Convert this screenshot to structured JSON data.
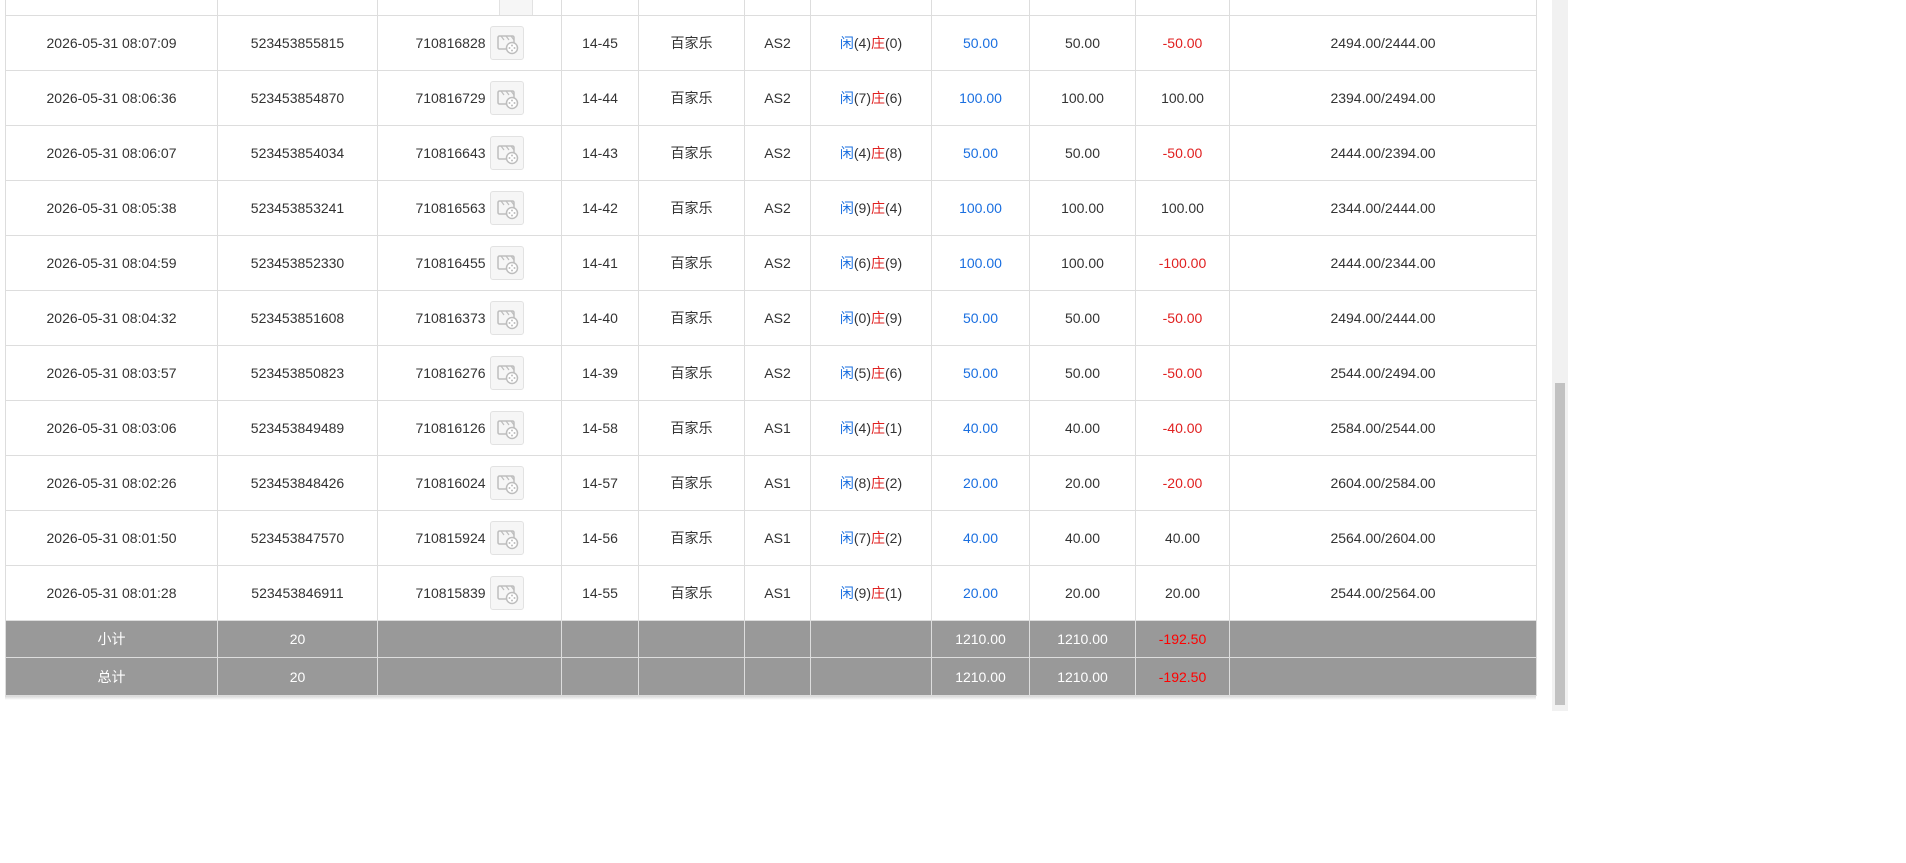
{
  "rows": [
    {
      "time": "2026-05-31 08:07:09",
      "order_id": "523453855815",
      "game_id": "710816828",
      "round": "14-45",
      "game": "百家乐",
      "table": "AS2",
      "player_label": "闲",
      "player_score": "(4)",
      "banker_label": "庄",
      "banker_score": "(0)",
      "bet": "50.00",
      "valid_bet": "50.00",
      "win_loss": "-50.00",
      "win_negative": true,
      "balance": "2494.00/2444.00"
    },
    {
      "time": "2026-05-31 08:06:36",
      "order_id": "523453854870",
      "game_id": "710816729",
      "round": "14-44",
      "game": "百家乐",
      "table": "AS2",
      "player_label": "闲",
      "player_score": "(7)",
      "banker_label": "庄",
      "banker_score": "(6)",
      "bet": "100.00",
      "valid_bet": "100.00",
      "win_loss": "100.00",
      "win_negative": false,
      "balance": "2394.00/2494.00"
    },
    {
      "time": "2026-05-31 08:06:07",
      "order_id": "523453854034",
      "game_id": "710816643",
      "round": "14-43",
      "game": "百家乐",
      "table": "AS2",
      "player_label": "闲",
      "player_score": "(4)",
      "banker_label": "庄",
      "banker_score": "(8)",
      "bet": "50.00",
      "valid_bet": "50.00",
      "win_loss": "-50.00",
      "win_negative": true,
      "balance": "2444.00/2394.00"
    },
    {
      "time": "2026-05-31 08:05:38",
      "order_id": "523453853241",
      "game_id": "710816563",
      "round": "14-42",
      "game": "百家乐",
      "table": "AS2",
      "player_label": "闲",
      "player_score": "(9)",
      "banker_label": "庄",
      "banker_score": "(4)",
      "bet": "100.00",
      "valid_bet": "100.00",
      "win_loss": "100.00",
      "win_negative": false,
      "balance": "2344.00/2444.00"
    },
    {
      "time": "2026-05-31 08:04:59",
      "order_id": "523453852330",
      "game_id": "710816455",
      "round": "14-41",
      "game": "百家乐",
      "table": "AS2",
      "player_label": "闲",
      "player_score": "(6)",
      "banker_label": "庄",
      "banker_score": "(9)",
      "bet": "100.00",
      "valid_bet": "100.00",
      "win_loss": "-100.00",
      "win_negative": true,
      "balance": "2444.00/2344.00"
    },
    {
      "time": "2026-05-31 08:04:32",
      "order_id": "523453851608",
      "game_id": "710816373",
      "round": "14-40",
      "game": "百家乐",
      "table": "AS2",
      "player_label": "闲",
      "player_score": "(0)",
      "banker_label": "庄",
      "banker_score": "(9)",
      "bet": "50.00",
      "valid_bet": "50.00",
      "win_loss": "-50.00",
      "win_negative": true,
      "balance": "2494.00/2444.00"
    },
    {
      "time": "2026-05-31 08:03:57",
      "order_id": "523453850823",
      "game_id": "710816276",
      "round": "14-39",
      "game": "百家乐",
      "table": "AS2",
      "player_label": "闲",
      "player_score": "(5)",
      "banker_label": "庄",
      "banker_score": "(6)",
      "bet": "50.00",
      "valid_bet": "50.00",
      "win_loss": "-50.00",
      "win_negative": true,
      "balance": "2544.00/2494.00"
    },
    {
      "time": "2026-05-31 08:03:06",
      "order_id": "523453849489",
      "game_id": "710816126",
      "round": "14-58",
      "game": "百家乐",
      "table": "AS1",
      "player_label": "闲",
      "player_score": "(4)",
      "banker_label": "庄",
      "banker_score": "(1)",
      "bet": "40.00",
      "valid_bet": "40.00",
      "win_loss": "-40.00",
      "win_negative": true,
      "balance": "2584.00/2544.00"
    },
    {
      "time": "2026-05-31 08:02:26",
      "order_id": "523453848426",
      "game_id": "710816024",
      "round": "14-57",
      "game": "百家乐",
      "table": "AS1",
      "player_label": "闲",
      "player_score": "(8)",
      "banker_label": "庄",
      "banker_score": "(2)",
      "bet": "20.00",
      "valid_bet": "20.00",
      "win_loss": "-20.00",
      "win_negative": true,
      "balance": "2604.00/2584.00"
    },
    {
      "time": "2026-05-31 08:01:50",
      "order_id": "523453847570",
      "game_id": "710815924",
      "round": "14-56",
      "game": "百家乐",
      "table": "AS1",
      "player_label": "闲",
      "player_score": "(7)",
      "banker_label": "庄",
      "banker_score": "(2)",
      "bet": "40.00",
      "valid_bet": "40.00",
      "win_loss": "40.00",
      "win_negative": false,
      "balance": "2564.00/2604.00"
    },
    {
      "time": "2026-05-31 08:01:28",
      "order_id": "523453846911",
      "game_id": "710815839",
      "round": "14-55",
      "game": "百家乐",
      "table": "AS1",
      "player_label": "闲",
      "player_score": "(9)",
      "banker_label": "庄",
      "banker_score": "(1)",
      "bet": "20.00",
      "valid_bet": "20.00",
      "win_loss": "20.00",
      "win_negative": false,
      "balance": "2544.00/2564.00"
    }
  ],
  "subtotal": {
    "label": "小计",
    "count": "20",
    "bet": "1210.00",
    "valid_bet": "1210.00",
    "win_loss": "-192.50"
  },
  "total": {
    "label": "总计",
    "count": "20",
    "bet": "1210.00",
    "valid_bet": "1210.00",
    "win_loss": "-192.50"
  },
  "icons": {
    "replay": "video-replay-icon"
  },
  "colors": {
    "player": "#1a6fe0",
    "banker": "#e02020",
    "negative": "#e02020",
    "summary_bg": "#999999"
  }
}
